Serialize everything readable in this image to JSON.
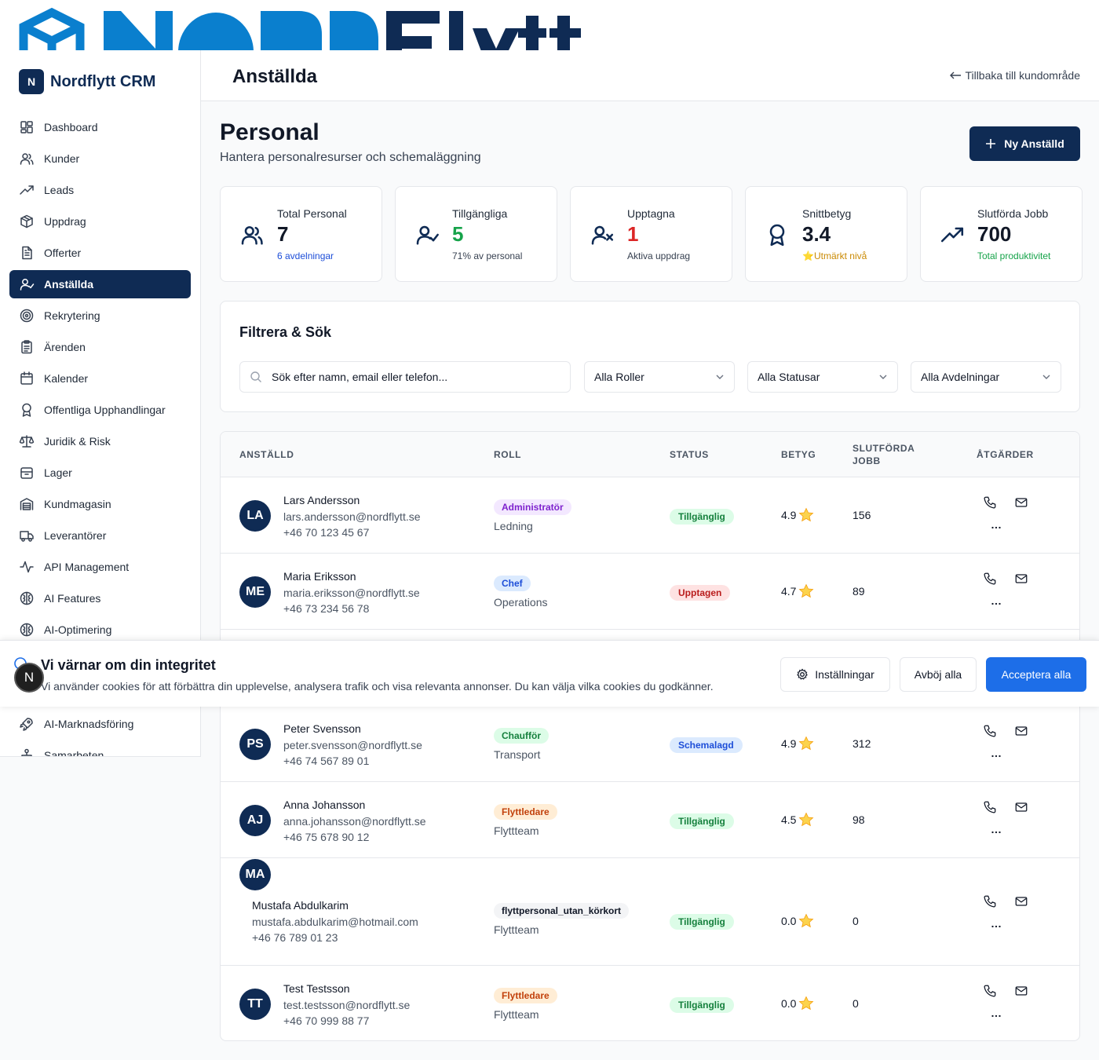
{
  "brand": {
    "badge": "N",
    "name": "Nordflytt CRM",
    "bubble": "N"
  },
  "sidebar": {
    "items": [
      {
        "label": "Dashboard",
        "icon": "dashboard-icon",
        "active": false
      },
      {
        "label": "Kunder",
        "icon": "users-icon",
        "active": false
      },
      {
        "label": "Leads",
        "icon": "trending-up-icon",
        "active": false
      },
      {
        "label": "Uppdrag",
        "icon": "package-icon",
        "active": false
      },
      {
        "label": "Offerter",
        "icon": "file-text-icon",
        "active": false
      },
      {
        "label": "Anställda",
        "icon": "user-check-icon",
        "active": true
      },
      {
        "label": "Rekrytering",
        "icon": "target-icon",
        "active": false
      },
      {
        "label": "Ärenden",
        "icon": "clipboard-icon",
        "active": false
      },
      {
        "label": "Kalender",
        "icon": "calendar-icon",
        "active": false
      },
      {
        "label": "Offentliga Upphandlingar",
        "icon": "award-icon",
        "active": false
      },
      {
        "label": "Juridik & Risk",
        "icon": "scale-icon",
        "active": false
      },
      {
        "label": "Lager",
        "icon": "archive-icon",
        "active": false
      },
      {
        "label": "Kundmagasin",
        "icon": "warehouse-icon",
        "active": false
      },
      {
        "label": "Leverantörer",
        "icon": "truck-icon",
        "active": false
      },
      {
        "label": "API Management",
        "icon": "activity-icon",
        "active": false
      },
      {
        "label": "AI Features",
        "icon": "brain-icon",
        "active": false
      },
      {
        "label": "AI-Optimering",
        "icon": "brain-icon",
        "active": false
      }
    ],
    "lower_items": [
      {
        "label": "AI-Marknadsföring",
        "icon": "rocket-icon"
      },
      {
        "label": "Samarbeten",
        "icon": "network-icon"
      }
    ]
  },
  "header": {
    "title": "Anställda",
    "back_link": "Tillbaka till kundområde"
  },
  "page": {
    "title": "Personal",
    "subtitle": "Hantera personalresurser och schemaläggning",
    "new_button": "Ny Anställd"
  },
  "stats": [
    {
      "label": "Total Personal",
      "value": "7",
      "foot": "6 avdelningar",
      "value_color": "#111827",
      "foot_color": "#1d4ed8",
      "icon": "users-icon"
    },
    {
      "label": "Tillgängliga",
      "value": "5",
      "foot": "71% av personal",
      "value_color": "#16a34a",
      "foot_color": "#374151",
      "icon": "user-check-icon"
    },
    {
      "label": "Upptagna",
      "value": "1",
      "foot": "Aktiva uppdrag",
      "value_color": "#dc2626",
      "foot_color": "#374151",
      "icon": "user-x-icon"
    },
    {
      "label": "Snittbetyg",
      "value": "3.4",
      "foot": "⭐Utmärkt nivå",
      "value_color": "#111827",
      "foot_color": "#ca8a04",
      "icon": "award-icon"
    },
    {
      "label": "Slutförda Jobb",
      "value": "700",
      "foot": "Total produktivitet",
      "value_color": "#111827",
      "foot_color": "#16a34a",
      "icon": "trending-up-icon"
    }
  ],
  "filters": {
    "title": "Filtrera & Sök",
    "search_placeholder": "Sök efter namn, email eller telefon...",
    "role_select": "Alla Roller",
    "status_select": "Alla Statusar",
    "department_select": "Alla Avdelningar"
  },
  "table": {
    "headers": {
      "employee": "ANSTÄLLD",
      "role": "ROLL",
      "status": "STATUS",
      "rating": "BETYG",
      "jobs_1": "SLUTFÖRDA",
      "jobs_2": "JOBB",
      "actions": "ÅTGÄRDER"
    },
    "rows": [
      {
        "initials": "LA",
        "name": "Lars Andersson",
        "email": "lars.andersson@nordflytt.se",
        "phone": "+46 70 123 45 67",
        "role": "Administratör",
        "role_color": "#7e22ce",
        "role_bg": "#f3e8ff",
        "dept": "Ledning",
        "status": "Tillgänglig",
        "status_color": "#15803d",
        "status_bg": "#dcfce7",
        "rating": "4.9",
        "jobs": "156"
      },
      {
        "initials": "ME",
        "name": "Maria Eriksson",
        "email": "maria.eriksson@nordflytt.se",
        "phone": "+46 73 234 56 78",
        "role": "Chef",
        "role_color": "#1d4ed8",
        "role_bg": "#dbeafe",
        "dept": "Operations",
        "status": "Upptagen",
        "status_color": "#b91c1c",
        "status_bg": "#fee2e2",
        "rating": "4.7",
        "jobs": "89"
      },
      {
        "initials": "PS",
        "name": "Peter Svensson",
        "email": "peter.svensson@nordflytt.se",
        "phone": "+46 74 567 89 01",
        "role": "Chaufför",
        "role_color": "#15803d",
        "role_bg": "#dcfce7",
        "dept": "Transport",
        "status": "Schemalagd",
        "status_color": "#1d4ed8",
        "status_bg": "#dbeafe",
        "rating": "4.9",
        "jobs": "312"
      },
      {
        "initials": "AJ",
        "name": "Anna Johansson",
        "email": "anna.johansson@nordflytt.se",
        "phone": "+46 75 678 90 12",
        "role": "Flyttledare",
        "role_color": "#c2410c",
        "role_bg": "#ffedd5",
        "dept": "Flyttteam",
        "status": "Tillgänglig",
        "status_color": "#15803d",
        "status_bg": "#dcfce7",
        "rating": "4.5",
        "jobs": "98"
      },
      {
        "initials": "MA",
        "name": "Mustafa Abdulkarim",
        "email": "mustafa.abdulkarim@hotmail.com",
        "phone": "+46 76 789 01 23",
        "role": "flyttpersonal_utan_körkort",
        "role_color": "#111827",
        "role_bg": "#f3f4f6",
        "dept": "Flyttteam",
        "status": "Tillgänglig",
        "status_color": "#15803d",
        "status_bg": "#dcfce7",
        "rating": "0.0",
        "jobs": "0"
      },
      {
        "initials": "TT",
        "name": "Test Testsson",
        "email": "test.testsson@nordflytt.se",
        "phone": "+46 70 999 88 77",
        "role": "Flyttledare",
        "role_color": "#c2410c",
        "role_bg": "#ffedd5",
        "dept": "Flyttteam",
        "status": "Tillgänglig",
        "status_color": "#15803d",
        "status_bg": "#dcfce7",
        "rating": "0.0",
        "jobs": "0"
      }
    ]
  },
  "cookie": {
    "title": "Vi värnar om din integritet",
    "text": "Vi använder cookies för att förbättra din upplevelse, analysera trafik och visa relevanta annonser. Du kan välja vilka cookies du godkänner.",
    "settings_button": "Inställningar",
    "reject_button": "Avböj alla",
    "accept_button": "Acceptera alla"
  },
  "colors": {
    "brand": "#0f2b54",
    "accent": "#1d6ee8"
  }
}
